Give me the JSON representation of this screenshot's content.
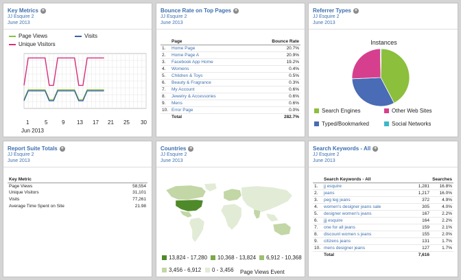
{
  "meta_sub": {
    "suite": "JJ Esquire 2",
    "period": "June 2013"
  },
  "key_metrics": {
    "title": "Key Metrics",
    "legend": [
      "Page Views",
      "Visits",
      "Unique Visitors"
    ],
    "colors": [
      "#8bbf3c",
      "#3560a8",
      "#d62b7a"
    ],
    "x_ticks": [
      "1",
      "5",
      "9",
      "13",
      "17",
      "21",
      "25",
      "30"
    ],
    "x_caption": "Jun 2013"
  },
  "bounce": {
    "title": "Bounce Rate on Top Pages",
    "col_page": "Page",
    "col_rate": "Bounce Rate",
    "rows": [
      {
        "n": "1.",
        "page": "Home Page",
        "rate": "20.7%"
      },
      {
        "n": "2.",
        "page": "Home Page A",
        "rate": "20.9%"
      },
      {
        "n": "3.",
        "page": "Facebook App Home",
        "rate": "19.2%"
      },
      {
        "n": "4.",
        "page": "Womens",
        "rate": "0.4%"
      },
      {
        "n": "5.",
        "page": "Children & Toys",
        "rate": "0.5%"
      },
      {
        "n": "6.",
        "page": "Beauty & Fragrance",
        "rate": "0.3%"
      },
      {
        "n": "7.",
        "page": "My Account",
        "rate": "0.6%"
      },
      {
        "n": "8.",
        "page": "Jewelry & Accessories",
        "rate": "0.6%"
      },
      {
        "n": "9.",
        "page": "Mens",
        "rate": "0.6%"
      },
      {
        "n": "10.",
        "page": "Error Page",
        "rate": "0.0%"
      }
    ],
    "total_label": "Total",
    "total_value": "282.7%"
  },
  "referrer": {
    "title": "Referrer Types",
    "pie_title": "Instances",
    "legend": [
      {
        "label": "Search Engines",
        "color": "#8bbf3c"
      },
      {
        "label": "Other Web Sites",
        "color": "#d63f8e"
      },
      {
        "label": "Typed/Bookmarked",
        "color": "#4a6bb5"
      },
      {
        "label": "Social Networks",
        "color": "#3cb8c8"
      }
    ]
  },
  "chart_data": {
    "type": "pie",
    "title": "Instances",
    "categories": [
      "Search Engines",
      "Typed/Bookmarked",
      "Other Web Sites",
      "Social Networks"
    ],
    "values": [
      42,
      32,
      25.5,
      0.5
    ]
  },
  "suite_totals": {
    "title": "Report Suite Totals",
    "col_header": "Key Metric",
    "rows": [
      {
        "label": "Page Views",
        "value": "58,554"
      },
      {
        "label": "Unique Visitors",
        "value": "31,101"
      },
      {
        "label": "Visits",
        "value": "77,261"
      },
      {
        "label": "Average Time Spent on Site",
        "value": "21.98"
      }
    ]
  },
  "countries": {
    "title": "Countries",
    "legend": [
      {
        "label": "13,824 - 17,280",
        "color": "#4f8a2a"
      },
      {
        "label": "10,368 - 13,824",
        "color": "#7ba84a"
      },
      {
        "label": "6,912 - 10,368",
        "color": "#9fbf73"
      },
      {
        "label": "3,456 - 6,912",
        "color": "#c3d6a6"
      },
      {
        "label": "0 - 3,456",
        "color": "#e2ebd6"
      }
    ],
    "caption": "Page Views Event"
  },
  "keywords": {
    "title": "Search Keywords - All",
    "col_kw": "Search Keywords - All",
    "col_searches": "Searches",
    "rows": [
      {
        "n": "1.",
        "kw": "jj esquire",
        "count": "1,281",
        "pct": "16.8%"
      },
      {
        "n": "2.",
        "kw": "jeans",
        "count": "1,217",
        "pct": "16.0%"
      },
      {
        "n": "3.",
        "kw": "peg leg jeans",
        "count": "372",
        "pct": "4.9%"
      },
      {
        "n": "4.",
        "kw": "women's designer jeans sale",
        "count": "305",
        "pct": "4.0%"
      },
      {
        "n": "5.",
        "kw": "designer women's jeans",
        "count": "167",
        "pct": "2.2%"
      },
      {
        "n": "6.",
        "kw": "jjj esquire",
        "count": "164",
        "pct": "2.2%"
      },
      {
        "n": "7.",
        "kw": "one for all jeans",
        "count": "159",
        "pct": "2.1%"
      },
      {
        "n": "8.",
        "kw": "discount women s jeans",
        "count": "155",
        "pct": "2.0%"
      },
      {
        "n": "9.",
        "kw": "citizens jeans",
        "count": "131",
        "pct": "1.7%"
      },
      {
        "n": "10.",
        "kw": "mens designer jeans",
        "count": "127",
        "pct": "1.7%"
      }
    ],
    "total_label": "Total",
    "total_value": "7,616"
  }
}
